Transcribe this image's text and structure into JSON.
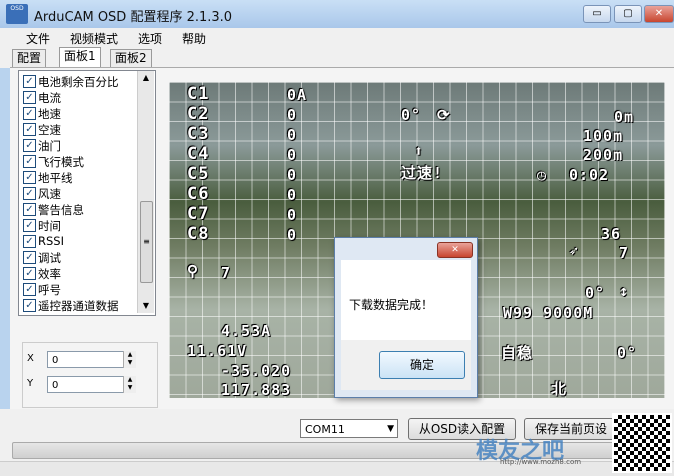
{
  "window": {
    "title": "ArduCAM OSD 配置程序 2.1.3.0",
    "icon_text": "OSD",
    "controls": {
      "minimize": "▭",
      "maximize": "▢",
      "close": "✕"
    }
  },
  "menu": [
    "文件",
    "视频模式",
    "选项",
    "帮助"
  ],
  "tabs": [
    "配置",
    "面板1",
    "面板2"
  ],
  "active_tab": "面板1",
  "panel_items": [
    {
      "label": "电池剩余百分比",
      "checked": true
    },
    {
      "label": "电流",
      "checked": true
    },
    {
      "label": "地速",
      "checked": true
    },
    {
      "label": "空速",
      "checked": true
    },
    {
      "label": "油门",
      "checked": true
    },
    {
      "label": "飞行模式",
      "checked": true
    },
    {
      "label": "地平线",
      "checked": true
    },
    {
      "label": "风速",
      "checked": true
    },
    {
      "label": "警告信息",
      "checked": true
    },
    {
      "label": "时间",
      "checked": true
    },
    {
      "label": "RSSI",
      "checked": true
    },
    {
      "label": "调试",
      "checked": true
    },
    {
      "label": "效率",
      "checked": true
    },
    {
      "label": "呼号",
      "checked": true
    },
    {
      "label": "遥控器通道数据",
      "checked": true
    }
  ],
  "position": {
    "x_label": "X",
    "x_value": "0",
    "y_label": "Y",
    "y_value": "0"
  },
  "osd": {
    "channels": [
      {
        "label": "C1",
        "value": "0A"
      },
      {
        "label": "C2",
        "value": "0"
      },
      {
        "label": "C3",
        "value": "0"
      },
      {
        "label": "C4",
        "value": "0"
      },
      {
        "label": "C5",
        "value": "0"
      },
      {
        "label": "C6",
        "value": "0"
      },
      {
        "label": "C7",
        "value": "0"
      },
      {
        "label": "C8",
        "value": "0"
      }
    ],
    "heading": "0°",
    "warning": "过速!",
    "altitude": "0m",
    "distance": "100m",
    "home_dist": "200m",
    "timer": "0:02",
    "wind_speed": "36",
    "wind2": "7",
    "sats": "7",
    "home_heading": "0°",
    "waypoint": "W99 9000M",
    "current": "4.53A",
    "voltage": "11.61V",
    "lat": "-35.020",
    "lon": "117.883",
    "mode": "自稳",
    "roll": "0°",
    "compass": "北"
  },
  "dialog": {
    "message": "下载数据完成！",
    "ok_label": "确定",
    "close_icon": "✕"
  },
  "bottom": {
    "com_port": "COM11",
    "read_button": "从OSD读入配置",
    "save_button": "保存当前页设"
  },
  "watermark": {
    "text": "模友之吧",
    "url": "http://www.mozh8.com"
  }
}
